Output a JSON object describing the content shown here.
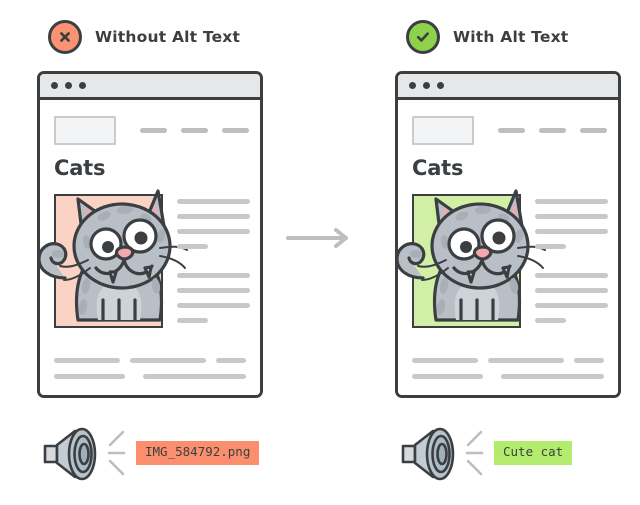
{
  "panels": [
    {
      "id": "without-alt-text",
      "header": {
        "label": "Without Alt Text",
        "icon": "circle-x-icon",
        "icon_variant": "bad",
        "badge_color": "#fb9272"
      },
      "browser": {
        "window_dots": 3,
        "heading": "Cats",
        "nav_items": 3,
        "image": {
          "frame_background": "#fbd3c5",
          "artwork": "cat-illustration",
          "alt_text_present": false
        },
        "paragraph_lines": [
          {
            "width": "100%"
          },
          {
            "width": "100%"
          },
          {
            "width": "100%"
          },
          {
            "width": "42%"
          },
          {
            "width": "100%"
          },
          {
            "width": "100%"
          },
          {
            "width": "100%"
          },
          {
            "width": "42%"
          }
        ],
        "footer_lines": [
          [
            88,
            101,
            40
          ],
          [
            76,
            109
          ]
        ]
      },
      "screen_reader": {
        "icon": "speaker-icon",
        "announcement": "IMG_584792.png",
        "badge_color": "#fb8f6d"
      }
    },
    {
      "id": "with-alt-text",
      "header": {
        "label": "With Alt Text",
        "icon": "circle-check-icon",
        "icon_variant": "good",
        "badge_color": "#8ed14a"
      },
      "browser": {
        "window_dots": 3,
        "heading": "Cats",
        "nav_items": 3,
        "image": {
          "frame_background": "#d2efa6",
          "artwork": "cat-illustration",
          "alt_text_present": true
        },
        "paragraph_lines": [
          {
            "width": "100%"
          },
          {
            "width": "100%"
          },
          {
            "width": "100%"
          },
          {
            "width": "42%"
          },
          {
            "width": "100%"
          },
          {
            "width": "100%"
          },
          {
            "width": "100%"
          },
          {
            "width": "42%"
          }
        ],
        "footer_lines": [
          [
            88,
            101,
            40
          ],
          [
            76,
            109
          ]
        ]
      },
      "screen_reader": {
        "icon": "speaker-icon",
        "announcement": "Cute cat",
        "badge_color": "#b3ec6d"
      }
    }
  ],
  "flow": {
    "arrow_icon": "arrow-right-icon",
    "arrow_color": "#bcbec0"
  },
  "colors": {
    "outline": "#3b3f42",
    "placeholder_gray": "#c6c8ca",
    "titlebar": "#e6e7e8",
    "bad": "#fb9272",
    "good": "#8ed14a",
    "image_bad_bg": "#fbd3c5",
    "image_good_bg": "#d2efa6"
  }
}
